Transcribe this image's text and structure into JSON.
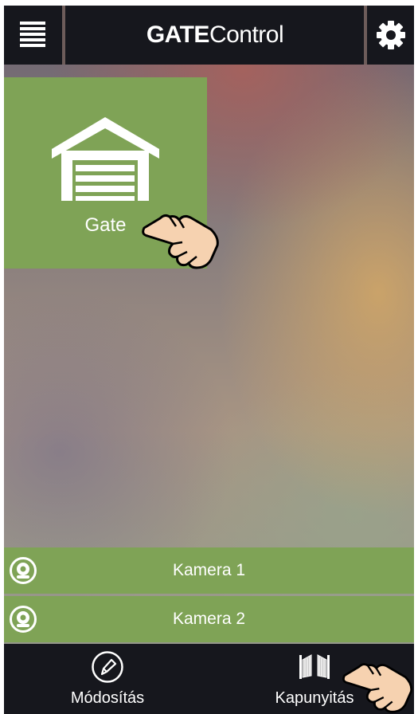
{
  "header": {
    "title_bold": "GATE",
    "title_light": "Control",
    "menu_icon": "hamburger-menu-icon",
    "settings_icon": "gear-icon"
  },
  "tiles": [
    {
      "label": "Gate",
      "icon": "garage-icon"
    }
  ],
  "cameras": [
    {
      "label": "Kamera 1",
      "icon": "webcam-icon"
    },
    {
      "label": "Kamera 2",
      "icon": "webcam-icon"
    }
  ],
  "bottom_nav": [
    {
      "label": "Módosítás",
      "icon": "pencil-icon"
    },
    {
      "label": "Kapunyitás",
      "icon": "gate-open-icon"
    }
  ],
  "colors": {
    "bar": "#16171d",
    "tile_green": "#7fa356"
  }
}
